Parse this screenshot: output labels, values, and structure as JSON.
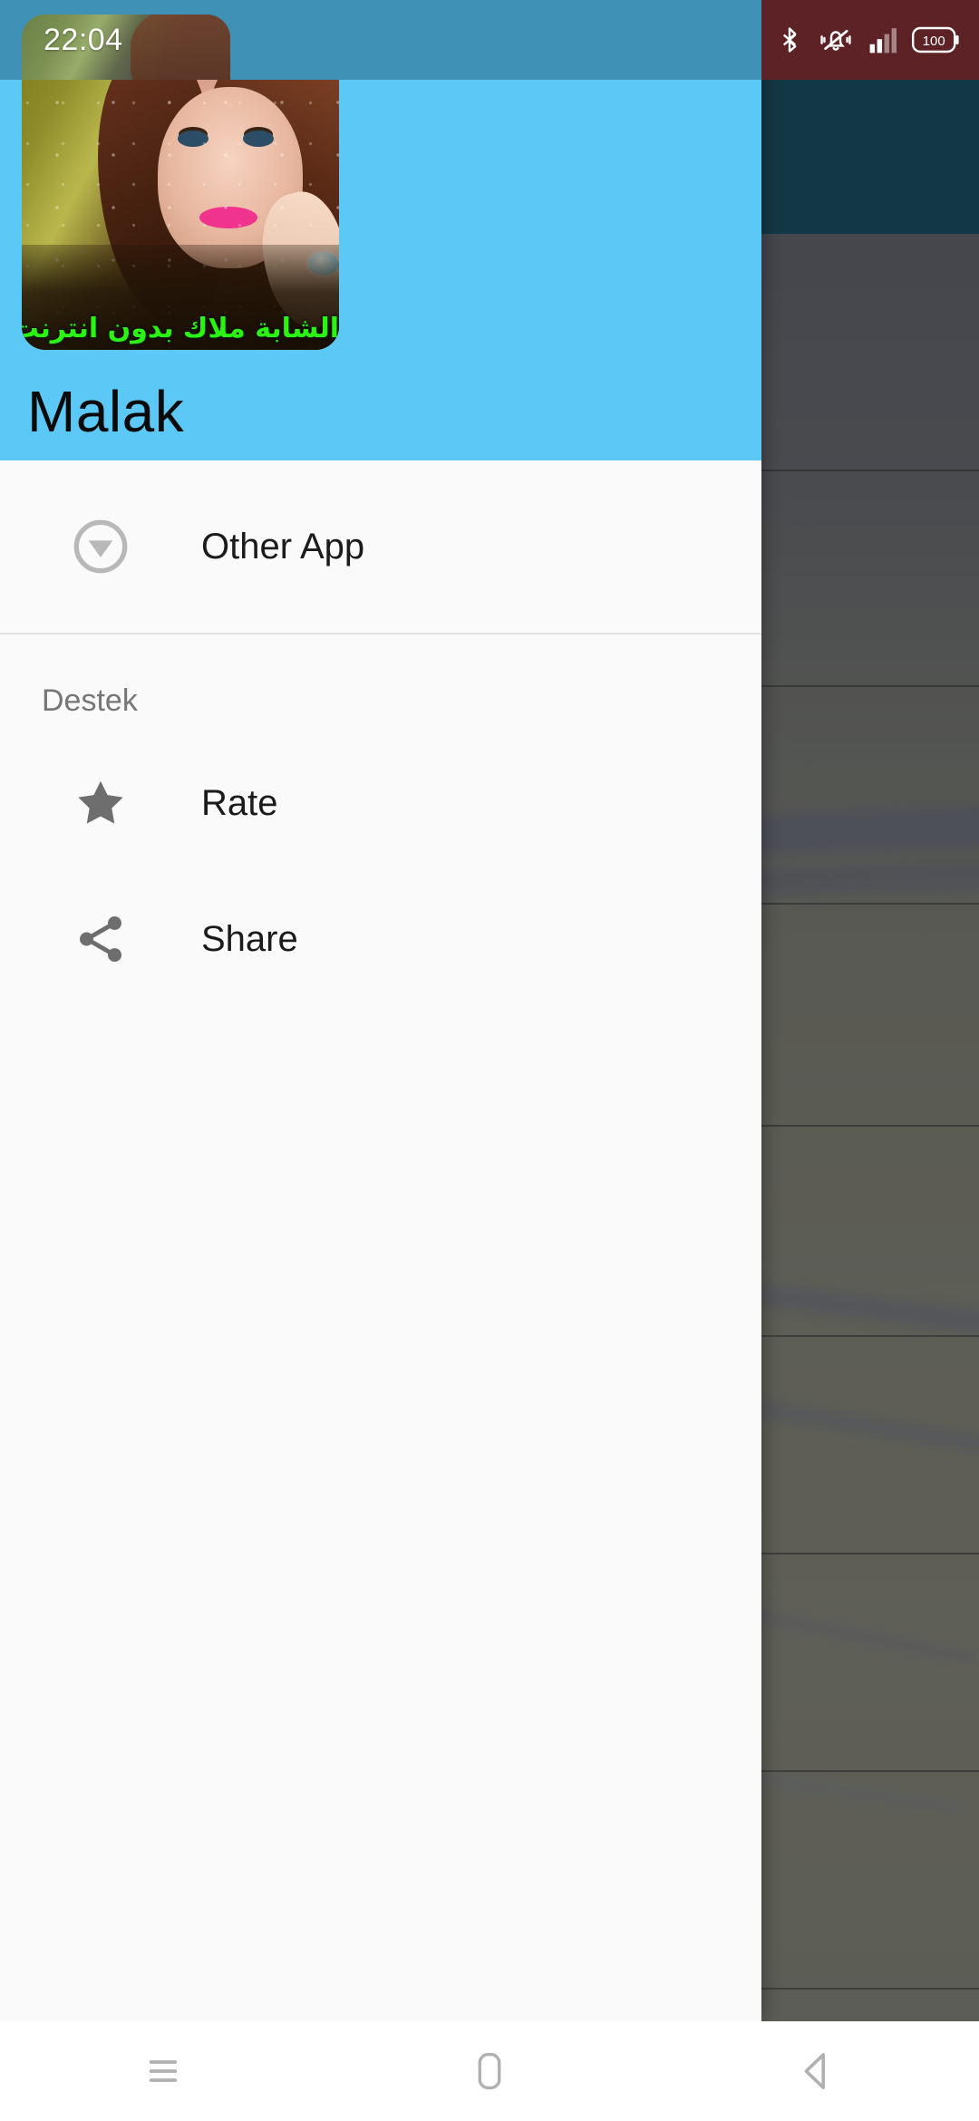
{
  "status_bar": {
    "time": "22:04",
    "icons": [
      {
        "name": "bluetooth-icon",
        "label": "Bluetooth"
      },
      {
        "name": "vibrate-mute-icon",
        "label": "Ringer vibrate"
      },
      {
        "name": "signal-bars-icon",
        "label": "Cellular signal"
      },
      {
        "name": "battery-icon",
        "label": "Battery"
      }
    ],
    "battery_level": "100",
    "left_bg_color": "#3f91b5",
    "right_bg_color": "#5c2226"
  },
  "drawer": {
    "header": {
      "app_title": "Malak",
      "icon_caption_arabic": "الشابة ملاك بدون انترنت",
      "background_color": "#5bc8f5",
      "title_color": "#0a0a0a"
    },
    "items": [
      {
        "id": "other-app",
        "label": "Other App",
        "icon": "circle-download-arrow-icon"
      }
    ],
    "sections": [
      {
        "id": "destek",
        "title": "Destek",
        "items": [
          {
            "id": "rate",
            "label": "Rate",
            "icon": "star-icon"
          },
          {
            "id": "share",
            "label": "Share",
            "icon": "share-nodes-icon"
          }
        ]
      }
    ],
    "surface_color": "#fafafa"
  },
  "background_app": {
    "toolbar_color": "#1d5468",
    "scrim_color": "rgba(0,0,0,0.33)",
    "list_row_count": 8
  },
  "navigation_bar": {
    "buttons": [
      {
        "id": "recents",
        "name": "recents-icon"
      },
      {
        "id": "home",
        "name": "home-icon"
      },
      {
        "id": "back",
        "name": "back-icon"
      }
    ],
    "background_color": "#ffffff",
    "icon_color": "#b0b0b0"
  }
}
